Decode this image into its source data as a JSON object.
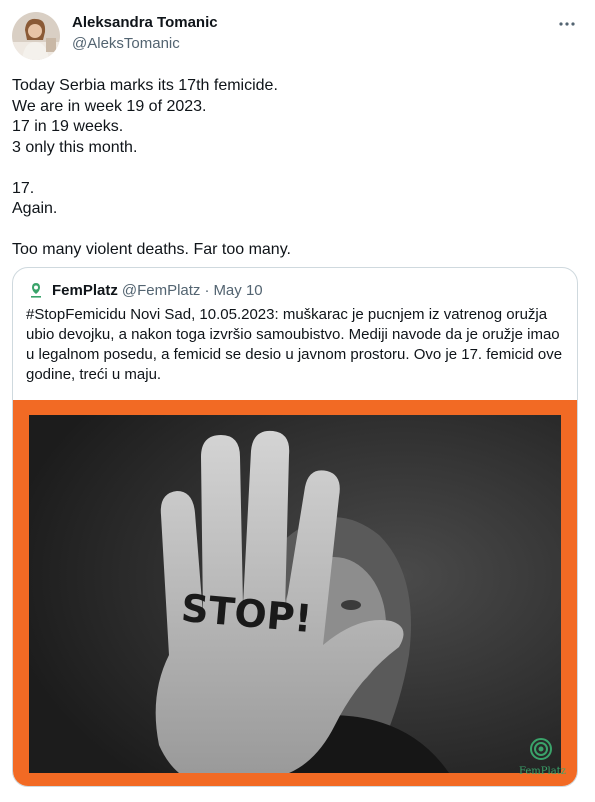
{
  "tweet": {
    "author_name": "Aleksandra Tomanic",
    "author_handle": "@AleksTomanic",
    "more_icon": "more-horizontal-icon",
    "lines": [
      "Today Serbia marks its 17th femicide.",
      "We are in week 19 of 2023.",
      "17 in 19 weeks.",
      "3 only this month.",
      "",
      "17.",
      "Again.",
      "",
      "Too many violent deaths. Far too many."
    ]
  },
  "quote": {
    "author_name": "FemPlatz",
    "author_handle": "@FemPlatz",
    "separator": "·",
    "date": "May 10",
    "text": "#StopFemicidu Novi Sad, 10.05.2023: muškarac je pucnjem iz vatrenog oružja ubio devojku, a nakon toga izvršio samoubistvo.  Mediji navode da je oružje imao u legalnom posedu, a femicid se desio u javnom prostoru. Ovo je 17. femicid ove godine, treći u maju.",
    "image": {
      "hand_text": "STOP!",
      "logo_text": "FemPlatz",
      "frame_color": "#f26a24",
      "logo_color": "#3aa36a"
    }
  }
}
